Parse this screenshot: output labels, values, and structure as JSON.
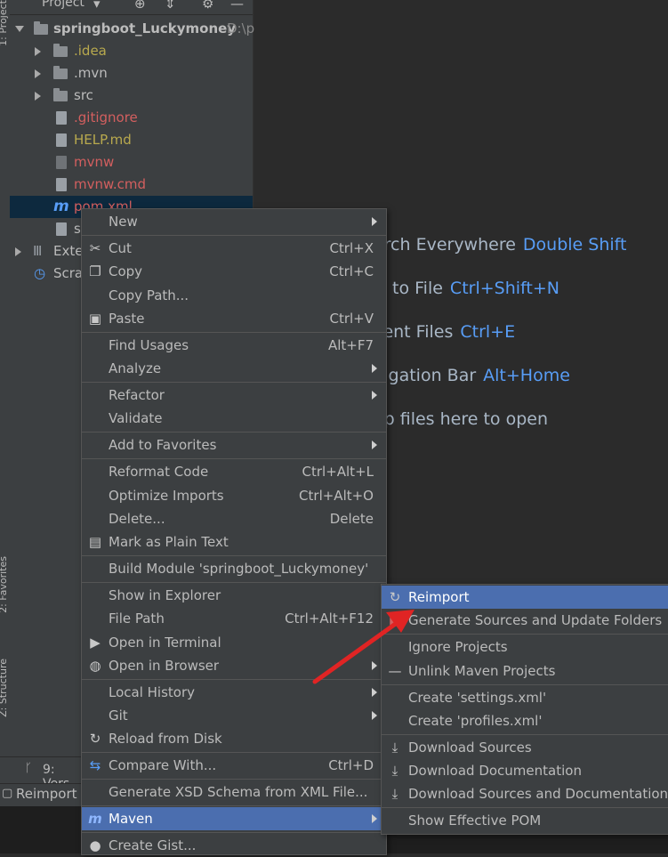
{
  "project_panel": {
    "title": "Project",
    "root_label": "springboot_Luckymoney",
    "root_path": "D:\\p",
    "items": [
      {
        "label": ".idea",
        "kind": "folder",
        "color": "yellow"
      },
      {
        "label": ".mvn",
        "kind": "folder",
        "color": "default"
      },
      {
        "label": "src",
        "kind": "folder",
        "color": "default"
      },
      {
        "label": ".gitignore",
        "kind": "file",
        "color": "red"
      },
      {
        "label": "HELP.md",
        "kind": "file",
        "color": "yellow"
      },
      {
        "label": "mvnw",
        "kind": "file",
        "color": "red"
      },
      {
        "label": "mvnw.cmd",
        "kind": "file",
        "color": "red"
      },
      {
        "label": "pom.xml",
        "kind": "maven-file",
        "color": "red"
      },
      {
        "label": "s",
        "kind": "file",
        "color": "default"
      },
      {
        "label": "Exte",
        "kind": "library",
        "color": "default"
      },
      {
        "label": "Scra",
        "kind": "scratch",
        "color": "default"
      }
    ]
  },
  "left_strip": {
    "project_tab": "1: Project",
    "favorites_tab": "2: Favorites",
    "structure_tab": "Z: Structure"
  },
  "bottom": {
    "version_control": "9: Vers",
    "status_text": "Reimport"
  },
  "editor_hints": [
    {
      "text": "arch Everywhere",
      "key": "Double Shift"
    },
    {
      "text": "to File",
      "key": "Ctrl+Shift+N"
    },
    {
      "text": "cent Files",
      "key": "Ctrl+E"
    },
    {
      "text": "vigation Bar",
      "key": "Alt+Home"
    },
    {
      "text": "op files here to open",
      "key": ""
    }
  ],
  "context_menu": {
    "new": "New",
    "cut": "Cut",
    "cut_sc": "Ctrl+X",
    "copy": "Copy",
    "copy_sc": "Ctrl+C",
    "copy_path": "Copy Path...",
    "paste": "Paste",
    "paste_sc": "Ctrl+V",
    "find_usages": "Find Usages",
    "find_usages_sc": "Alt+F7",
    "analyze": "Analyze",
    "refactor": "Refactor",
    "validate": "Validate",
    "add_to_favorites": "Add to Favorites",
    "reformat_code": "Reformat Code",
    "reformat_code_sc": "Ctrl+Alt+L",
    "optimize_imports": "Optimize Imports",
    "optimize_imports_sc": "Ctrl+Alt+O",
    "delete": "Delete...",
    "delete_sc": "Delete",
    "mark_plain": "Mark as Plain Text",
    "build_module": "Build Module 'springboot_Luckymoney'",
    "show_in_explorer": "Show in Explorer",
    "file_path": "File Path",
    "file_path_sc": "Ctrl+Alt+F12",
    "open_in_terminal": "Open in Terminal",
    "open_in_browser": "Open in Browser",
    "local_history": "Local History",
    "git": "Git",
    "reload_from_disk": "Reload from Disk",
    "compare_with": "Compare With...",
    "compare_with_sc": "Ctrl+D",
    "generate_xsd": "Generate XSD Schema from XML File...",
    "maven": "Maven",
    "create_gist": "Create Gist..."
  },
  "maven_submenu": {
    "reimport": "Reimport",
    "generate_sources": "Generate Sources and Update Folders",
    "ignore_projects": "Ignore Projects",
    "unlink": "Unlink Maven Projects",
    "create_settings": "Create 'settings.xml'",
    "create_profiles": "Create 'profiles.xml'",
    "download_sources": "Download Sources",
    "download_docs": "Download Documentation",
    "download_both": "Download Sources and Documentation",
    "show_effective_pom": "Show Effective POM"
  },
  "colors": {
    "highlight": "#4b6eaf",
    "annotation_arrow": "#e02424"
  }
}
